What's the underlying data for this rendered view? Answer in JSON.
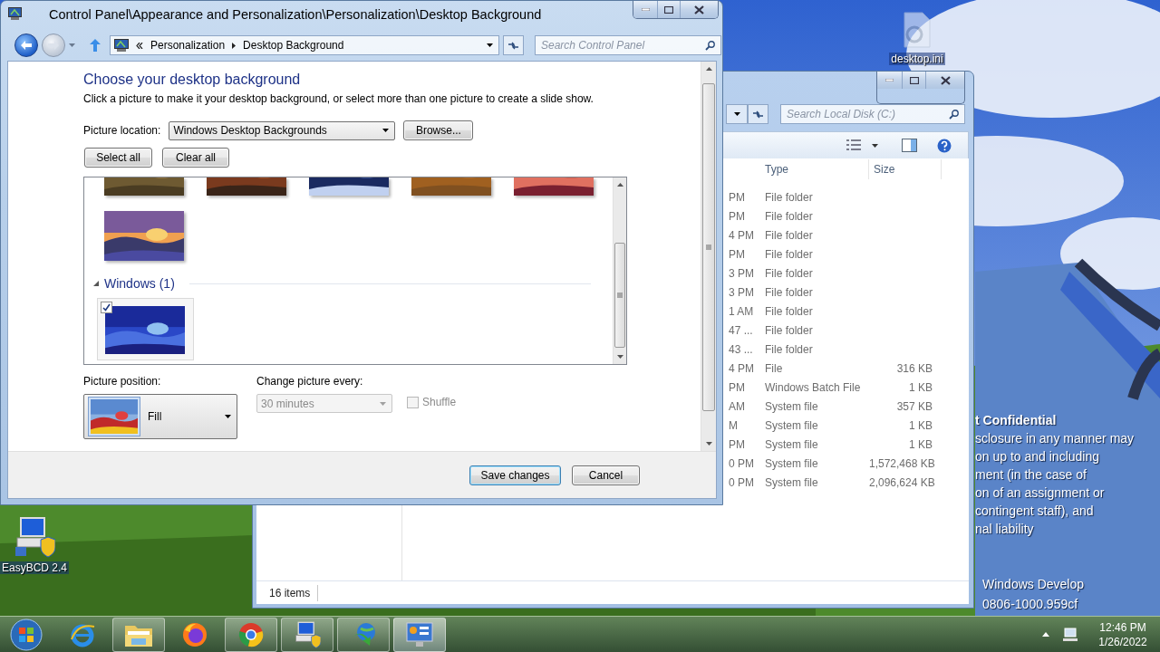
{
  "desktop": {
    "icons": [
      {
        "kind": "settings-file",
        "label": "desktop.ini"
      },
      {
        "kind": "boot-tool",
        "label": "EasyBCD 2.4"
      }
    ],
    "notice": {
      "title": "t Confidential",
      "lines": [
        "sclosure in any manner may",
        "on up to and including",
        "ment (in the case of",
        "on of an assignment or",
        "contingent staff), and",
        "nal liability"
      ]
    },
    "build_text": [
      "Windows Develop",
      "0806-1000.959cf"
    ]
  },
  "explorer_window": {
    "search": {
      "placeholder": "Search Local Disk (C:)"
    },
    "columns": [
      "Type",
      "Size"
    ],
    "rows": [
      {
        "date": "PM",
        "type": "File folder"
      },
      {
        "date": "PM",
        "type": "File folder"
      },
      {
        "date": "4 PM",
        "type": "File folder"
      },
      {
        "date": "PM",
        "type": "File folder"
      },
      {
        "date": "3 PM",
        "type": "File folder"
      },
      {
        "date": "3 PM",
        "type": "File folder"
      },
      {
        "date": "1 AM",
        "type": "File folder"
      },
      {
        "date": "47 ...",
        "type": "File folder"
      },
      {
        "date": "43 ...",
        "type": "File folder"
      },
      {
        "date": "4 PM",
        "type": "File",
        "size": "316 KB"
      },
      {
        "date": "PM",
        "type": "Windows Batch File",
        "size": "1 KB"
      },
      {
        "date": "AM",
        "type": "System file",
        "size": "357 KB"
      },
      {
        "date": "M",
        "type": "System file",
        "size": "1 KB"
      },
      {
        "date": "PM",
        "type": "System file",
        "size": "1 KB"
      },
      {
        "date": "0 PM",
        "type": "System file",
        "size": "1,572,468 KB"
      },
      {
        "date": "0 PM",
        "type": "System file",
        "size": "2,096,624 KB"
      }
    ],
    "status": "16 items"
  },
  "control_panel_window": {
    "title": "Control Panel\\Appearance and Personalization\\Personalization\\Desktop Background",
    "breadcrumb": [
      "Personalization",
      "Desktop Background"
    ],
    "search": {
      "placeholder": "Search Control Panel"
    },
    "heading": "Choose your desktop background",
    "description": "Click a picture to make it your desktop background, or select more than one picture to create a slide show.",
    "picture_location": {
      "label": "Picture location:",
      "value": "Windows Desktop Backgrounds"
    },
    "browse_button": "Browse...",
    "selection_buttons": [
      "Select all",
      "Clear all"
    ],
    "gallery": {
      "items_above": [
        {
          "kind": "picture"
        },
        {
          "kind": "picture"
        },
        {
          "kind": "picture"
        },
        {
          "kind": "picture"
        },
        {
          "kind": "picture"
        }
      ],
      "last_row": [
        {
          "kind": "picture"
        }
      ],
      "groups": [
        {
          "name": "Windows (1)",
          "expanded": true,
          "items": [
            {
              "kind": "picture",
              "checked": true,
              "selected": true
            }
          ]
        }
      ]
    },
    "picture_position": {
      "label": "Picture position:",
      "value": "Fill"
    },
    "change_picture": {
      "label": "Change picture every:",
      "value": "30 minutes",
      "disabled": true
    },
    "shuffle": {
      "label": "Shuffle",
      "checked": false,
      "disabled": true
    },
    "footer_buttons": [
      {
        "label": "Save changes",
        "focused": true
      },
      {
        "label": "Cancel",
        "focused": false
      }
    ]
  },
  "taskbar": {
    "apps": [
      {
        "kind": "browser-e",
        "running": false,
        "active": false
      },
      {
        "kind": "folder",
        "running": true,
        "active": false
      },
      {
        "kind": "fox",
        "running": false,
        "active": false
      },
      {
        "kind": "chrome",
        "running": true,
        "active": false
      },
      {
        "kind": "boot-tool",
        "running": true,
        "active": false
      },
      {
        "kind": "download",
        "running": true,
        "active": false
      },
      {
        "kind": "control-panel",
        "running": true,
        "active": true
      }
    ],
    "clock": {
      "time": "12:46 PM",
      "date": "1/26/2022"
    }
  }
}
